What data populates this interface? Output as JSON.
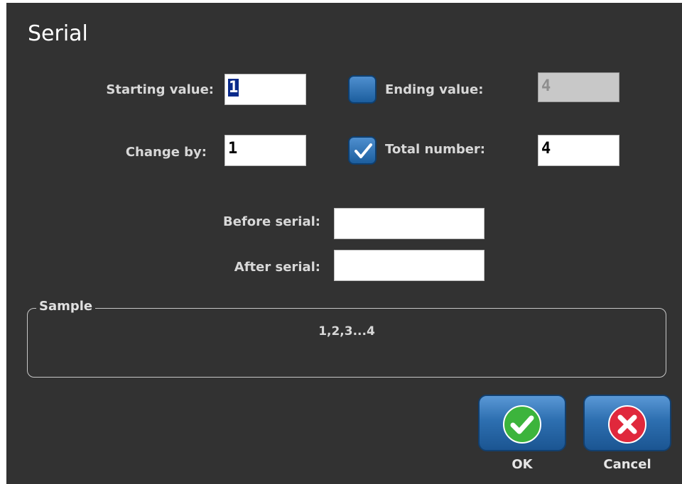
{
  "dialog": {
    "title": "Serial"
  },
  "fields": {
    "starting_value": {
      "label": "Starting value:",
      "value": "1"
    },
    "change_by": {
      "label": "Change by:",
      "value": "1"
    },
    "ending_value": {
      "label": "Ending value:",
      "value": "4",
      "checked": false,
      "enabled": false
    },
    "total_number": {
      "label": "Total number:",
      "value": "4",
      "checked": true
    },
    "before_serial": {
      "label": "Before serial:",
      "value": ""
    },
    "after_serial": {
      "label": "After serial:",
      "value": ""
    }
  },
  "sample": {
    "legend": "Sample",
    "text": "1,2,3...4"
  },
  "buttons": {
    "ok": {
      "label": "OK",
      "icon": "check-icon",
      "color": "#3cb43c"
    },
    "cancel": {
      "label": "Cancel",
      "icon": "close-icon",
      "color": "#e0283c"
    }
  },
  "colors": {
    "background": "#323232",
    "button_blue": "#2d6fb0"
  }
}
